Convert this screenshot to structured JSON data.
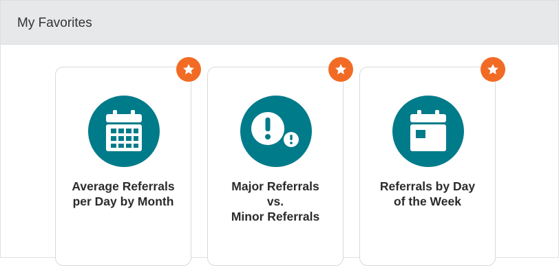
{
  "panel": {
    "title": "My Favorites"
  },
  "colors": {
    "accent_teal": "#007b8a",
    "favorite_orange": "#f26b24",
    "header_bg": "#e6e8ea"
  },
  "cards": [
    {
      "label": "Average Referrals\nper Day by Month",
      "icon": "calendar-grid-icon",
      "favorited": true
    },
    {
      "label": "Major Referrals\nvs.\nMinor Referrals",
      "icon": "exclamation-icon",
      "favorited": true
    },
    {
      "label": "Referrals by Day\nof the Week",
      "icon": "calendar-day-icon",
      "favorited": true
    }
  ]
}
